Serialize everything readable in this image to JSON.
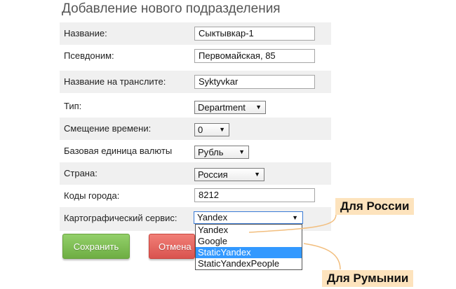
{
  "page_title": "Добавление нового подразделения",
  "form": {
    "name": {
      "label": "Название:",
      "value": "Сыктывкар-1"
    },
    "alias": {
      "label": "Псевдоним:",
      "value": "Первомайская, 85"
    },
    "translit": {
      "label": "Название на транслите:",
      "value": "Syktyvkar"
    },
    "type": {
      "label": "Тип:",
      "value": "Department"
    },
    "timezone": {
      "label": "Смещение времени:",
      "value": "0"
    },
    "currency": {
      "label": "Базовая единица валюты",
      "value": "Рубль"
    },
    "country": {
      "label": "Страна:",
      "value": "Россия"
    },
    "city_codes": {
      "label": "Коды города:",
      "value": "8212"
    },
    "map_service": {
      "label": "Картографический сервис:",
      "value": "Yandex",
      "options": [
        "Yandex",
        "Google",
        "StaticYandex",
        "StaticYandexPeople"
      ],
      "highlighted_option": "StaticYandex"
    }
  },
  "buttons": {
    "save": "Сохранить",
    "cancel": "Отмена"
  },
  "annotations": {
    "russia": "Для России",
    "romania": "Для Румынии"
  },
  "colors": {
    "callout_bg": "#fde3bd",
    "save_button": "#7dbd55",
    "cancel_button": "#e25b55",
    "option_highlight": "#3399ff"
  }
}
